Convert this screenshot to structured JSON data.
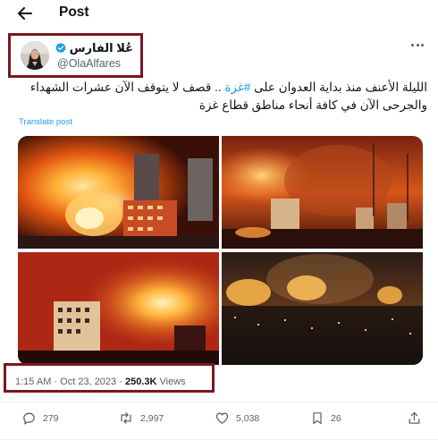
{
  "header": {
    "back_icon": "arrow-left-icon",
    "title": "Post"
  },
  "author": {
    "display_name": "عُلا الفارس",
    "handle": "@OlaAlfares",
    "verified": true,
    "verified_color": "#1d9bf0"
  },
  "tweet": {
    "text_before": "الليلة الأعنف منذ بداية العدوان على ",
    "hashtag": "#غزة",
    "text_after": " .. قصف لا يتوقف  الآن عشرات الشهداء والجرحى الآن في كافة أنحاء مناطق قطاع غزة",
    "translate_label": "Translate post"
  },
  "meta": {
    "time": "1:15 AM",
    "separator": "·",
    "date": "Oct 23, 2023",
    "views_count": "250.3K",
    "views_label": "Views"
  },
  "actions": {
    "replies": "279",
    "reposts": "2,997",
    "likes": "5,038",
    "bookmarks": "26"
  },
  "colors": {
    "accent": "#1d9bf0",
    "highlight_box": "#7a1721",
    "secondary_text": "#536471"
  }
}
